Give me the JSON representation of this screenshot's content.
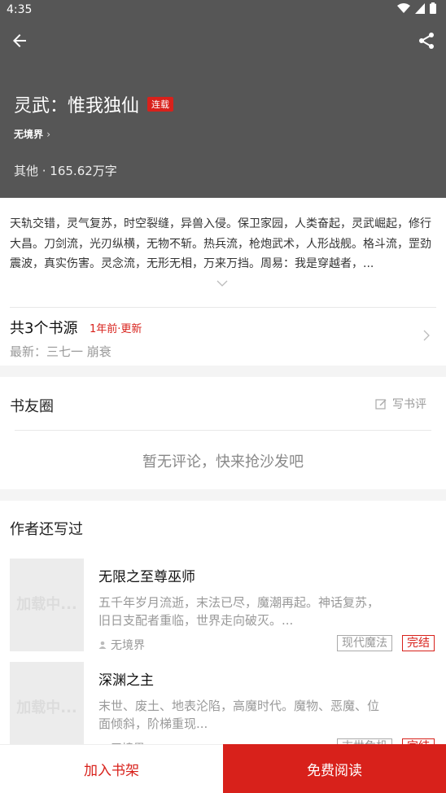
{
  "status_bar": {
    "time": "4:35"
  },
  "book": {
    "title": "灵武：惟我独仙",
    "status_badge": "连载",
    "author": "无境界",
    "meta": "其他 · 165.62万字",
    "description": "天轨交错，灵气复苏，时空裂缝，异兽入侵。保卫家园，人类奋起，灵武崛起，修行大昌。刀剑流，光刃纵横，无物不斩。热兵流，枪炮武术，人形战舰。格斗流，罡劲震波，真实伤害。灵念流，无形无相，万来万挡。周易：我是穿越者，..."
  },
  "sources": {
    "title": "共3个书源",
    "update": "1年前·更新",
    "latest": "最新：三七一 崩衰"
  },
  "circle": {
    "title": "书友圈",
    "write_label": "写书评",
    "empty_text": "暂无评论，快来抢沙发吧"
  },
  "author_works": {
    "title": "作者还写过",
    "items": [
      {
        "cover_text": "加载中...",
        "title": "无限之至尊巫师",
        "desc": "五千年岁月流逝，末法已尽，魔潮再起。神话复苏，旧日支配者重临，世界走向破灭。...",
        "author": "无境界",
        "genre": "现代魔法",
        "status": "完结"
      },
      {
        "cover_text": "加载中...",
        "title": "深渊之主",
        "desc": "末世、废土、地表沦陷，高魔时代。魔物、恶魔、位面倾斜，阶梯重现...",
        "author": "无境界",
        "genre": "末世危机",
        "status": "完结"
      }
    ]
  },
  "bottom_bar": {
    "add_label": "加入书架",
    "read_label": "免费阅读"
  },
  "colors": {
    "accent": "#d8211b",
    "header_bg": "#565656"
  }
}
